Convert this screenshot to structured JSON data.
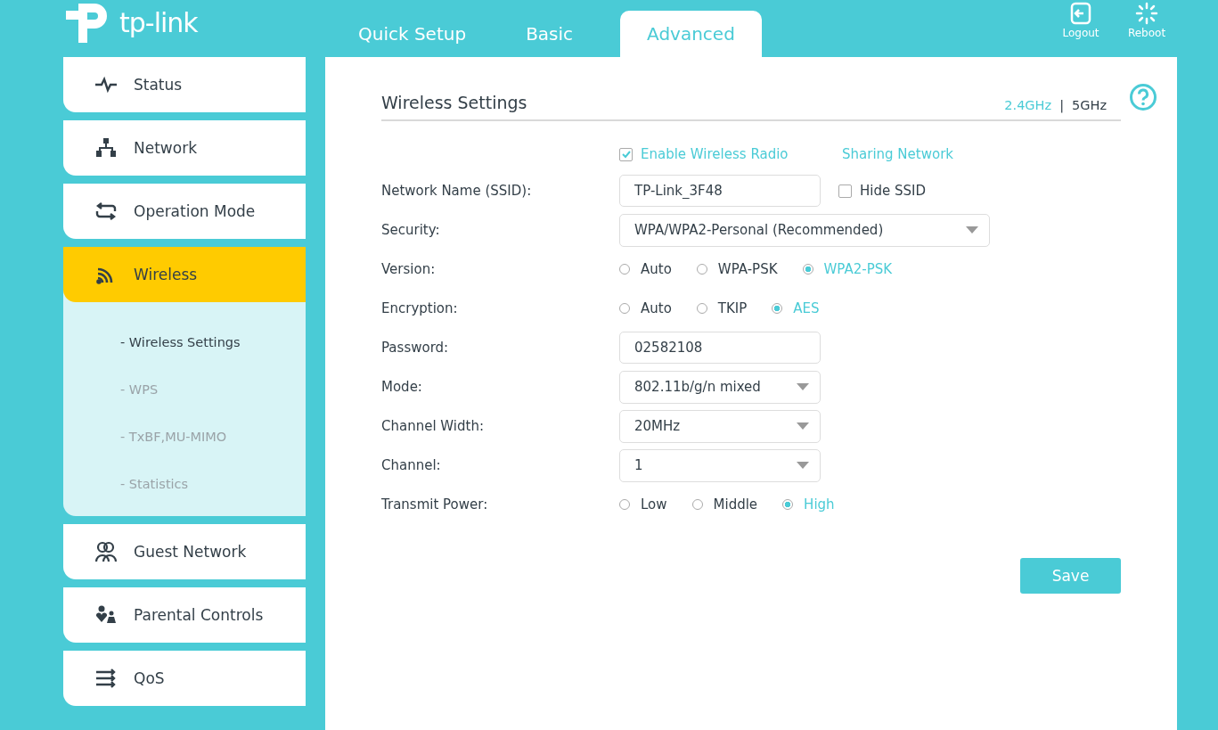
{
  "brand": {
    "name": "tp-link"
  },
  "tabs": [
    {
      "label": "Quick Setup",
      "selected": false
    },
    {
      "label": "Basic",
      "selected": false
    },
    {
      "label": "Advanced",
      "selected": true
    }
  ],
  "header_actions": [
    {
      "kind": "logout",
      "label": "Logout"
    },
    {
      "kind": "reboot",
      "label": "Reboot"
    }
  ],
  "sidebar": {
    "items": [
      {
        "label": "Status",
        "selected": false
      },
      {
        "label": "Network",
        "selected": false
      },
      {
        "label": "Operation Mode",
        "selected": false
      },
      {
        "label": "Wireless",
        "selected": true,
        "children": [
          {
            "label": "- Wireless Settings",
            "selected": true
          },
          {
            "label": "- WPS",
            "selected": false
          },
          {
            "label": "- TxBF,MU-MIMO",
            "selected": false
          },
          {
            "label": "- Statistics",
            "selected": false
          }
        ]
      },
      {
        "label": "Guest Network",
        "selected": false
      },
      {
        "label": "Parental Controls",
        "selected": false
      },
      {
        "label": "QoS",
        "selected": false
      }
    ]
  },
  "section": {
    "title": "Wireless Settings",
    "separator": "|",
    "bands": [
      {
        "label": "2.4GHz",
        "selected": true
      },
      {
        "label": "5GHz",
        "selected": false
      }
    ]
  },
  "enable_radio": {
    "label": "Enable Wireless Radio",
    "checked": true
  },
  "sharing_link": "Sharing Network",
  "fields": [
    {
      "kind": "text",
      "label": "Network Name (SSID):",
      "value": "TP-Link_3F48",
      "extra": {
        "label": "Hide SSID",
        "checked": false
      }
    },
    {
      "kind": "wideselect",
      "label": "Security:",
      "value": "WPA/WPA2-Personal (Recommended)"
    },
    {
      "kind": "radio",
      "label": "Version:",
      "options": [
        {
          "label": "Auto",
          "selected": false
        },
        {
          "label": "WPA-PSK",
          "selected": false
        },
        {
          "label": "WPA2-PSK",
          "selected": true
        }
      ]
    },
    {
      "kind": "radio",
      "label": "Encryption:",
      "options": [
        {
          "label": "Auto",
          "selected": false
        },
        {
          "label": "TKIP",
          "selected": false
        },
        {
          "label": "AES",
          "selected": true
        }
      ]
    },
    {
      "kind": "text",
      "label": "Password:",
      "value": "02582108"
    },
    {
      "kind": "select",
      "label": "Mode:",
      "value": "802.11b/g/n mixed"
    },
    {
      "kind": "select",
      "label": "Channel Width:",
      "value": "20MHz"
    },
    {
      "kind": "select",
      "label": "Channel:",
      "value": "1"
    },
    {
      "kind": "radio",
      "label": "Transmit Power:",
      "options": [
        {
          "label": "Low",
          "selected": false
        },
        {
          "label": "Middle",
          "selected": false
        },
        {
          "label": "High",
          "selected": true
        }
      ]
    }
  ],
  "save_button": "Save"
}
